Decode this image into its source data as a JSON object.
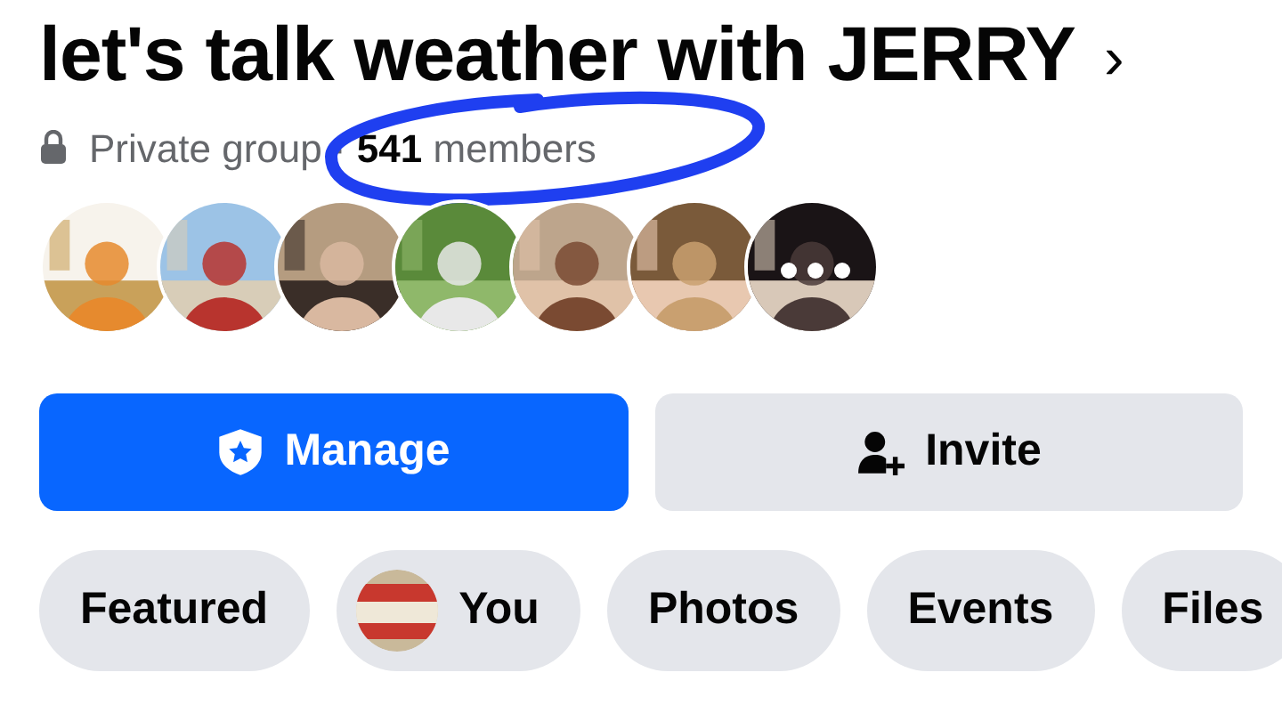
{
  "group": {
    "title": "let's talk weather with JERRY",
    "chevron": "›",
    "subtitle": "Private group · **541** members"
  },
  "annotation": {
    "kind": "ellipse"
  },
  "members": [
    {
      "kind": "picture"
    },
    {
      "kind": "picture"
    },
    {
      "kind": "picture"
    },
    {
      "kind": "picture"
    },
    {
      "kind": "picture"
    },
    {
      "kind": "picture"
    },
    {
      "kind": "more"
    }
  ],
  "actions": [
    {
      "kind": "primary",
      "label": "Manage"
    },
    {
      "kind": "secondary",
      "label": "Invite"
    }
  ],
  "tabs": [
    {
      "label": "Featured",
      "selected": false
    },
    {
      "label": "You",
      "selected": false,
      "kind": "avatar"
    },
    {
      "label": "Photos",
      "selected": false
    },
    {
      "label": "Events",
      "selected": false
    },
    {
      "label": "Files",
      "selected": false
    }
  ]
}
